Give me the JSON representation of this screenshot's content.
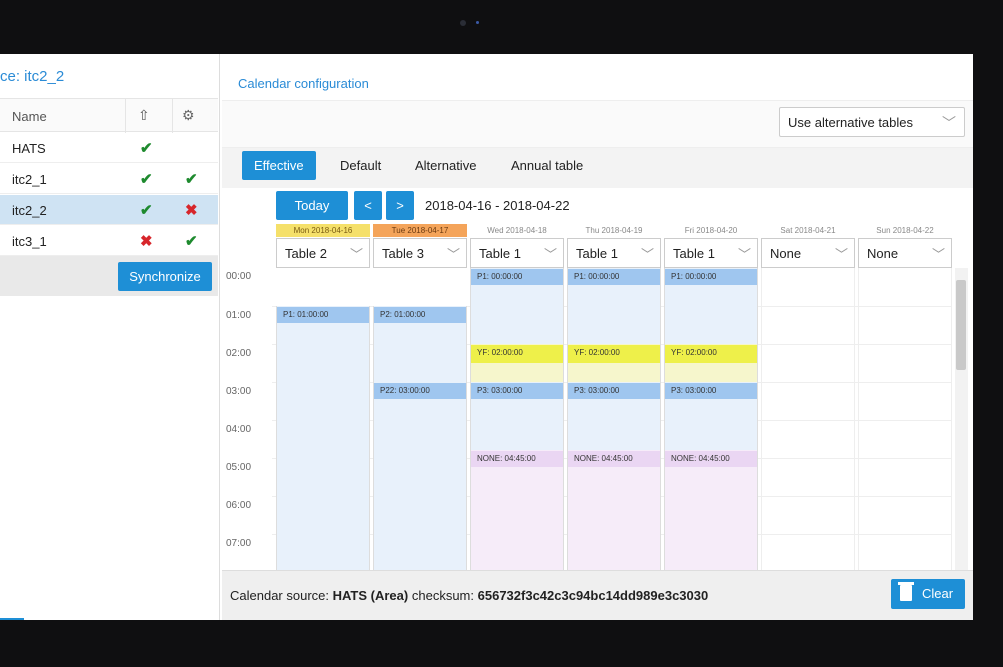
{
  "left_panel": {
    "title": "ce: itc2_2",
    "col_name": "Name",
    "col_upload_icon": "upload-icon",
    "col_settings_icon": "gear-icon",
    "rows": [
      {
        "name": "HATS",
        "s1": "✔",
        "s2": ""
      },
      {
        "name": "itc2_1",
        "s1": "✔",
        "s2": "✔"
      },
      {
        "name": "itc2_2",
        "s1": "✔",
        "s2": "✖"
      },
      {
        "name": "itc3_1",
        "s1": "✖",
        "s2": "✔"
      }
    ],
    "sync_label": "Synchronize"
  },
  "main": {
    "title": "Calendar configuration",
    "alt_select": "Use alternative tables",
    "tabs": [
      "Effective",
      "Default",
      "Alternative",
      "Annual table"
    ],
    "today": "Today",
    "prev": "<",
    "next": ">",
    "range": "2018-04-16 - 2018-04-22"
  },
  "calendar": {
    "days": [
      {
        "date": "Mon 2018-04-16",
        "table": "Table 2"
      },
      {
        "date": "Tue 2018-04-17",
        "table": "Table 3"
      },
      {
        "date": "Wed 2018-04-18",
        "table": "Table 1"
      },
      {
        "date": "Thu 2018-04-19",
        "table": "Table 1"
      },
      {
        "date": "Fri 2018-04-20",
        "table": "Table 1"
      },
      {
        "date": "Sat 2018-04-21",
        "table": "None"
      },
      {
        "date": "Sun 2018-04-22",
        "table": "None"
      }
    ],
    "times": [
      "00:00",
      "01:00",
      "02:00",
      "03:00",
      "04:00",
      "05:00",
      "06:00",
      "07:00"
    ],
    "slots": {
      "mon_p1": "P1: 01:00:00",
      "tue_p2": "P2: 01:00:00",
      "tue_p22": "P22: 03:00:00",
      "wed_p1": "P1: 00:00:00",
      "thu_p1": "P1: 00:00:00",
      "fri_p1": "P1: 00:00:00",
      "wed_yf": "YF: 02:00:00",
      "thu_yf": "YF: 02:00:00",
      "fri_yf": "YF: 02:00:00",
      "wed_p3": "P3: 03:00:00",
      "thu_p3": "P3: 03:00:00",
      "fri_p3": "P3: 03:00:00",
      "wed_none": "NONE: 04:45:00",
      "thu_none": "NONE: 04:45:00",
      "fri_none": "NONE: 04:45:00"
    }
  },
  "footer": {
    "prefix": "Calendar source:",
    "source": "HATS (Area)",
    "checksum_label": "checksum:",
    "checksum": "656732f3c42c3c94bc14dd989e3c3030",
    "clear": "Clear"
  },
  "colors": {
    "accent": "#1e8fd6",
    "blue_slot": "#dbeafc",
    "yellow_slot": "#f1f27a",
    "pink_slot": "#f3e8f8"
  }
}
